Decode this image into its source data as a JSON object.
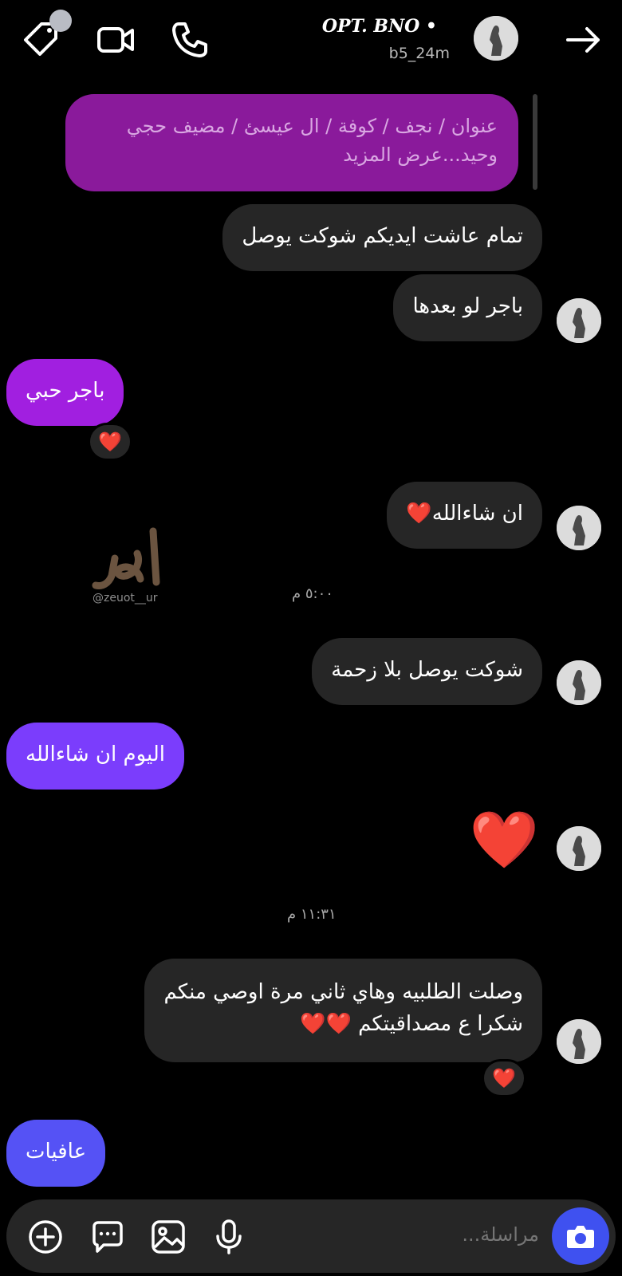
{
  "header": {
    "contact_name": "OPT. BNO •",
    "contact_status": "b5_24m",
    "icons": [
      "tag-icon",
      "video-call-icon",
      "phone-icon",
      "arrow-right-icon"
    ]
  },
  "messages": {
    "quoted_reply": "عنوان / نجف / كوفة / ال عيسئ / مضيف حجي وحيد...عرض المزيد",
    "m1": "تمام عاشت ايديكم شوكت يوصل",
    "m2": "باجر لو بعدها",
    "m3": "باجر حبي",
    "m3_reaction": "❤️",
    "m4": "ان شاءالله❤️",
    "time1": "٥:٠٠ م",
    "m5": "شوكت يوصل بلا زحمة",
    "m6": "اليوم ان شاءالله",
    "m7": "❤️",
    "time2": "١١:٣١ م",
    "m8_line1": "وصلت الطلبيه وهاي ثاني مرة اوصي منكم",
    "m8_line2": "شكرا ع مصداقيتكم ❤️❤️",
    "m8_reaction": "❤️",
    "m9": "عافيات"
  },
  "watermark": {
    "text": "@zeuot__ur"
  },
  "composer": {
    "placeholder": "مراسلة..."
  },
  "colors": {
    "background": "#000000",
    "received_bubble": "#262626",
    "quoted_bubble": "#8a1a9b",
    "sent_gradient_top": "#a120e0",
    "sent_gradient_mid": "#7b3dfc",
    "sent_gradient_bottom": "#5552f5",
    "camera_button": "#3f51f0"
  }
}
